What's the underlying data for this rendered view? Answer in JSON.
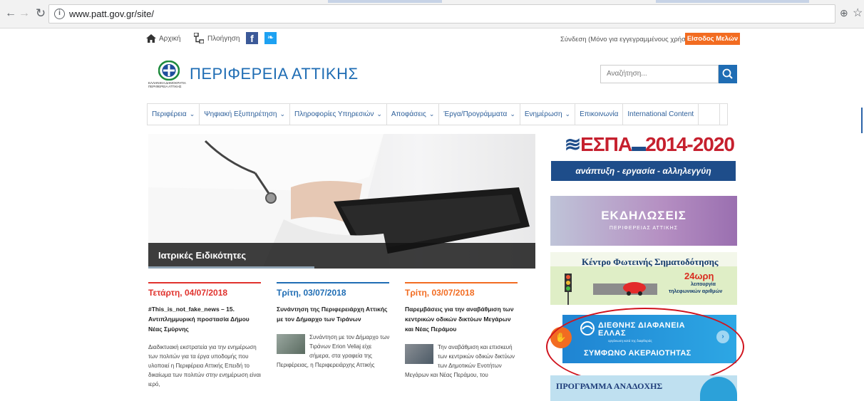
{
  "browser": {
    "url": "www.patt.gov.gr/site/"
  },
  "topbar": {
    "home_label": "Αρχική",
    "sitemap_label": "Πλοήγηση",
    "login_text": "Σύνδεση (Μόνο για εγγεγραμμένους χρήστες)",
    "members_button": "Είσοδος Μελών"
  },
  "logo": {
    "title": "ΠΕΡΙΦΕΡΕΙΑ ΑΤΤΙΚΗΣ",
    "small_line1": "ΕΛΛΗΝΙΚΗ ΔΗΜΟΚΡΑΤΙΑ",
    "small_line2": "ΠΕΡΙΦΕΡΕΙΑ ΑΤΤΙΚΗΣ"
  },
  "search": {
    "placeholder": "Αναζήτηση..."
  },
  "nav": {
    "items": [
      {
        "label": "Περιφέρεια",
        "dropdown": true
      },
      {
        "label": "Ψηφιακή Εξυπηρέτηση",
        "dropdown": true
      },
      {
        "label": "Πληροφορίες Υπηρεσιών",
        "dropdown": true
      },
      {
        "label": "Αποφάσεις",
        "dropdown": true
      },
      {
        "label": "Έργα/Προγράμματα",
        "dropdown": true
      },
      {
        "label": "Ενημέρωση",
        "dropdown": true
      },
      {
        "label": "Επικοινωνία",
        "dropdown": false
      },
      {
        "label": "International Content",
        "dropdown": false
      }
    ],
    "dropdown_glyph": "⌄"
  },
  "slider": {
    "caption": "Ιατρικές Ειδικότητες",
    "progress": 0.43
  },
  "news": [
    {
      "date": "Τετάρτη, 04/07/2018",
      "color": "#e0322d",
      "title": "#This_is_not_fake_news – 15. Αντιπλημμυρική προστασία Δήμου Νέας Σμύρνης",
      "body": "Διαδικτυακή εκστρατεία για την ενημέρωση των πολιτών για τα έργα υποδομής που υλοποιεί η Περιφέρεια Αττικής Επειδή το δικαίωμα των πολιτών στην ενημέρωση είναι ιερό,"
    },
    {
      "date": "Τρίτη, 03/07/2018",
      "color": "#1f6db4",
      "title": "Συνάντηση της Περιφερειάρχη Αττικής με τον Δήμαρχο των Τιράνων",
      "body": "Συνάντηση με τον Δήμαρχο των Τιράνων Erion Veliaj είχε σήμερα, στα γραφεία της Περιφέρειας, η Περιφερειάρχης Αττικής"
    },
    {
      "date": "Τρίτη, 03/07/2018",
      "color": "#f26c21",
      "title": "Παρεμβάσεις για την αναβάθμιση των κεντρικών οδικών δικτύων Μεγάρων και Νέας Περάμου",
      "body": "Την αναβάθμιση και επισκευή των κεντρικών οδικών δικτύων των Δημοτικών Ενοτήτων Μεγάρων και Νέας Περάμου, του"
    }
  ],
  "ads": {
    "espa_title": "ΕΣΠΑ",
    "espa_years": "2014-2020",
    "espa_sub": "ανάπτυξη - εργασία - αλληλεγγύη",
    "events_title": "ΕΚΔΗΛΩΣΕΙΣ",
    "events_sub": "ΠΕΡΙΦΕΡΕΙΑΣ ΑΤΤΙΚΗΣ",
    "lights_title": "Κέντρο Φωτεινής Σηματοδότησης",
    "lights_hours": "24ωρη",
    "lights_sub1": "λειτουργία",
    "lights_sub2": "τηλεφωνικών αριθμών",
    "integrity_line1": "ΔΙΕΘΝΗΣ ΔΙΑΦΑΝΕΙΑ",
    "integrity_line2": "ΕΛΛΑΣ",
    "integrity_sub": "οργάνωση κατά της διαφθοράς",
    "integrity_pact": "ΣΥΜΦΩΝΟ ΑΚΕΡΑΙΟΤΗΤΑΣ",
    "adoption_title": "ΠΡΟΓΡΑΜΜΑ ΑΝΑΔΟΧΗΣ"
  },
  "colors": {
    "brand_blue": "#1f6db4",
    "accent_orange": "#f26c21",
    "highlight_red": "#d0131d"
  }
}
